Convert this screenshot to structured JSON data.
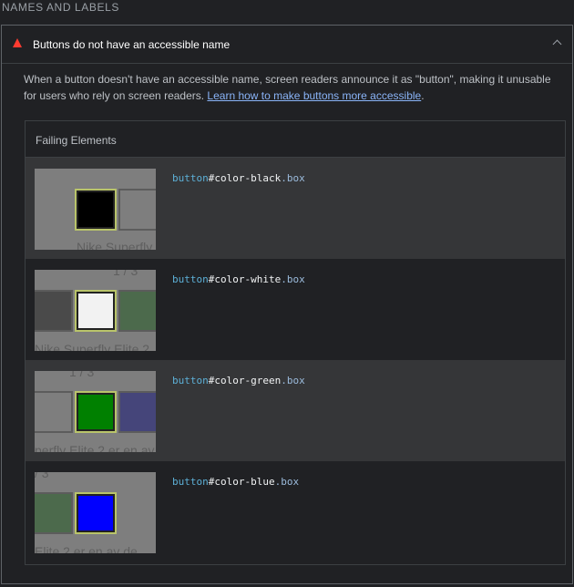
{
  "section": {
    "title": "NAMES AND LABELS"
  },
  "audit": {
    "title": "Buttons do not have an accessible name",
    "description_prefix": "When a button doesn't have an accessible name, screen readers announce it as \"button\", making it unusable for users who rely on screen readers. ",
    "link_text": "Learn how to make buttons more accessible",
    "description_suffix": "."
  },
  "failing": {
    "header": "Failing Elements",
    "rows": [
      {
        "tag": "button",
        "id": "#color-black",
        "cls": ".box",
        "thumb_texts": [
          "Nike Superfly"
        ]
      },
      {
        "tag": "button",
        "id": "#color-white",
        "cls": ".box",
        "thumb_texts": [
          "1 / 3",
          "Nike Superfly Elite 2"
        ]
      },
      {
        "tag": "button",
        "id": "#color-green",
        "cls": ".box",
        "thumb_texts": [
          "1 / 3",
          "perfly Elite 2 er en av"
        ]
      },
      {
        "tag": "button",
        "id": "#color-blue",
        "cls": ".box",
        "thumb_texts": [
          "/ 3",
          "Elite 2 er en av de"
        ]
      }
    ]
  },
  "colors": {
    "black": "#000000",
    "white": "#f2f2f2",
    "green": "#008000",
    "blue": "#0000ff",
    "muted_green": "#4c6a4c",
    "muted_blue": "#45457a",
    "muted_dark": "#4a4a4a"
  }
}
